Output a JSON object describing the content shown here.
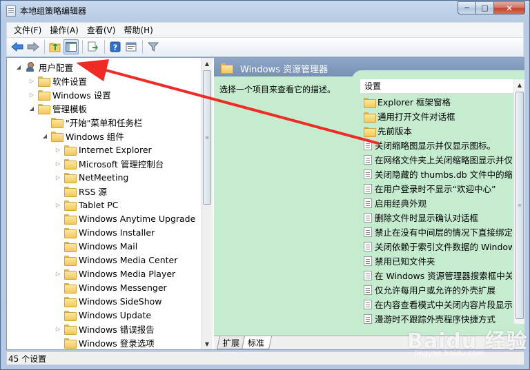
{
  "window": {
    "title": "本地组策略编辑器",
    "controls": {
      "minimize": "─",
      "maximize": "□",
      "close": "✕"
    }
  },
  "menu": [
    "文件(F)",
    "操作(A)",
    "查看(V)",
    "帮助(H)"
  ],
  "toolbar": {
    "icons": [
      "back-icon",
      "forward-icon",
      "up-folder-icon",
      "show-hide-tree-icon",
      "export-list-icon",
      "help-icon",
      "properties-icon",
      "filter-icon"
    ]
  },
  "tree": {
    "items": [
      {
        "label": "用户配置",
        "level": 0,
        "expander": "open",
        "icon": "user-icon"
      },
      {
        "label": "软件设置",
        "level": 1,
        "expander": "closed",
        "icon": "folder-icon"
      },
      {
        "label": "Windows 设置",
        "level": 1,
        "expander": "closed",
        "icon": "folder-icon"
      },
      {
        "label": "管理模板",
        "level": 1,
        "expander": "open",
        "icon": "folder-icon"
      },
      {
        "label": "\"开始\"菜单和任务栏",
        "level": 2,
        "expander": "none",
        "icon": "folder-icon"
      },
      {
        "label": "Windows 组件",
        "level": 2,
        "expander": "open",
        "icon": "folder-icon"
      },
      {
        "label": "Internet Explorer",
        "level": 3,
        "expander": "closed",
        "icon": "folder-icon"
      },
      {
        "label": "Microsoft 管理控制台",
        "level": 3,
        "expander": "closed",
        "icon": "folder-icon"
      },
      {
        "label": "NetMeeting",
        "level": 3,
        "expander": "closed",
        "icon": "folder-icon"
      },
      {
        "label": "RSS 源",
        "level": 3,
        "expander": "none",
        "icon": "folder-icon"
      },
      {
        "label": "Tablet PC",
        "level": 3,
        "expander": "closed",
        "icon": "folder-icon"
      },
      {
        "label": "Windows Anytime Upgrade",
        "level": 3,
        "expander": "none",
        "icon": "folder-icon"
      },
      {
        "label": "Windows Installer",
        "level": 3,
        "expander": "none",
        "icon": "folder-icon"
      },
      {
        "label": "Windows Mail",
        "level": 3,
        "expander": "none",
        "icon": "folder-icon"
      },
      {
        "label": "Windows Media Center",
        "level": 3,
        "expander": "none",
        "icon": "folder-icon"
      },
      {
        "label": "Windows Media Player",
        "level": 3,
        "expander": "closed",
        "icon": "folder-icon"
      },
      {
        "label": "Windows Messenger",
        "level": 3,
        "expander": "none",
        "icon": "folder-icon"
      },
      {
        "label": "Windows SideShow",
        "level": 3,
        "expander": "none",
        "icon": "folder-icon"
      },
      {
        "label": "Windows Update",
        "level": 3,
        "expander": "none",
        "icon": "folder-icon"
      },
      {
        "label": "Windows 错误报告",
        "level": 3,
        "expander": "closed",
        "icon": "folder-icon"
      },
      {
        "label": "Windows 登录选项",
        "level": 3,
        "expander": "none",
        "icon": "folder-icon"
      }
    ]
  },
  "right_pane": {
    "header_title": "Windows 资源管理器",
    "description": "选择一个项目来查看它的描述。",
    "column_header": "设置",
    "items": [
      {
        "label": "Explorer 框架窗格",
        "type": "folder"
      },
      {
        "label": "通用打开文件对话框",
        "type": "folder"
      },
      {
        "label": "先前版本",
        "type": "folder"
      },
      {
        "label": "关闭缩略图显示并仅显示图标。",
        "type": "policy"
      },
      {
        "label": "在网络文件夹上关闭缩略图显示并仅显",
        "type": "policy"
      },
      {
        "label": "关闭隐藏的 thumbs.db 文件中的缩略",
        "type": "policy"
      },
      {
        "label": "在用户登录时不显示“欢迎中心”",
        "type": "policy"
      },
      {
        "label": "启用经典外观",
        "type": "policy"
      },
      {
        "label": "删除文件时显示确认对话框",
        "type": "policy"
      },
      {
        "label": "禁止在没有中间层的情况下直接绑定到",
        "type": "policy"
      },
      {
        "label": "关闭依赖于索引文件数据的 Window",
        "type": "policy"
      },
      {
        "label": "禁用已知文件夹",
        "type": "policy"
      },
      {
        "label": "在 Windows 资源管理器搜索框中关闭",
        "type": "policy"
      },
      {
        "label": "仅允许每用户或允许的外壳扩展",
        "type": "policy"
      },
      {
        "label": "在内容查看模式中关闭内容片段显示",
        "type": "policy"
      },
      {
        "label": "漫游时不跟踪外壳程序快捷方式",
        "type": "policy"
      }
    ],
    "tabs": [
      "扩展",
      "标准"
    ],
    "active_tab": 1
  },
  "status": {
    "text": "45 个设置"
  },
  "watermark": {
    "text": "Baidu 经验",
    "sub": "jingyan.baidu.com"
  },
  "colors": {
    "right_pane_bg": "#c6ecd0",
    "header_bg": "#7f98bb",
    "annotation_arrow": "#ee2b24"
  }
}
